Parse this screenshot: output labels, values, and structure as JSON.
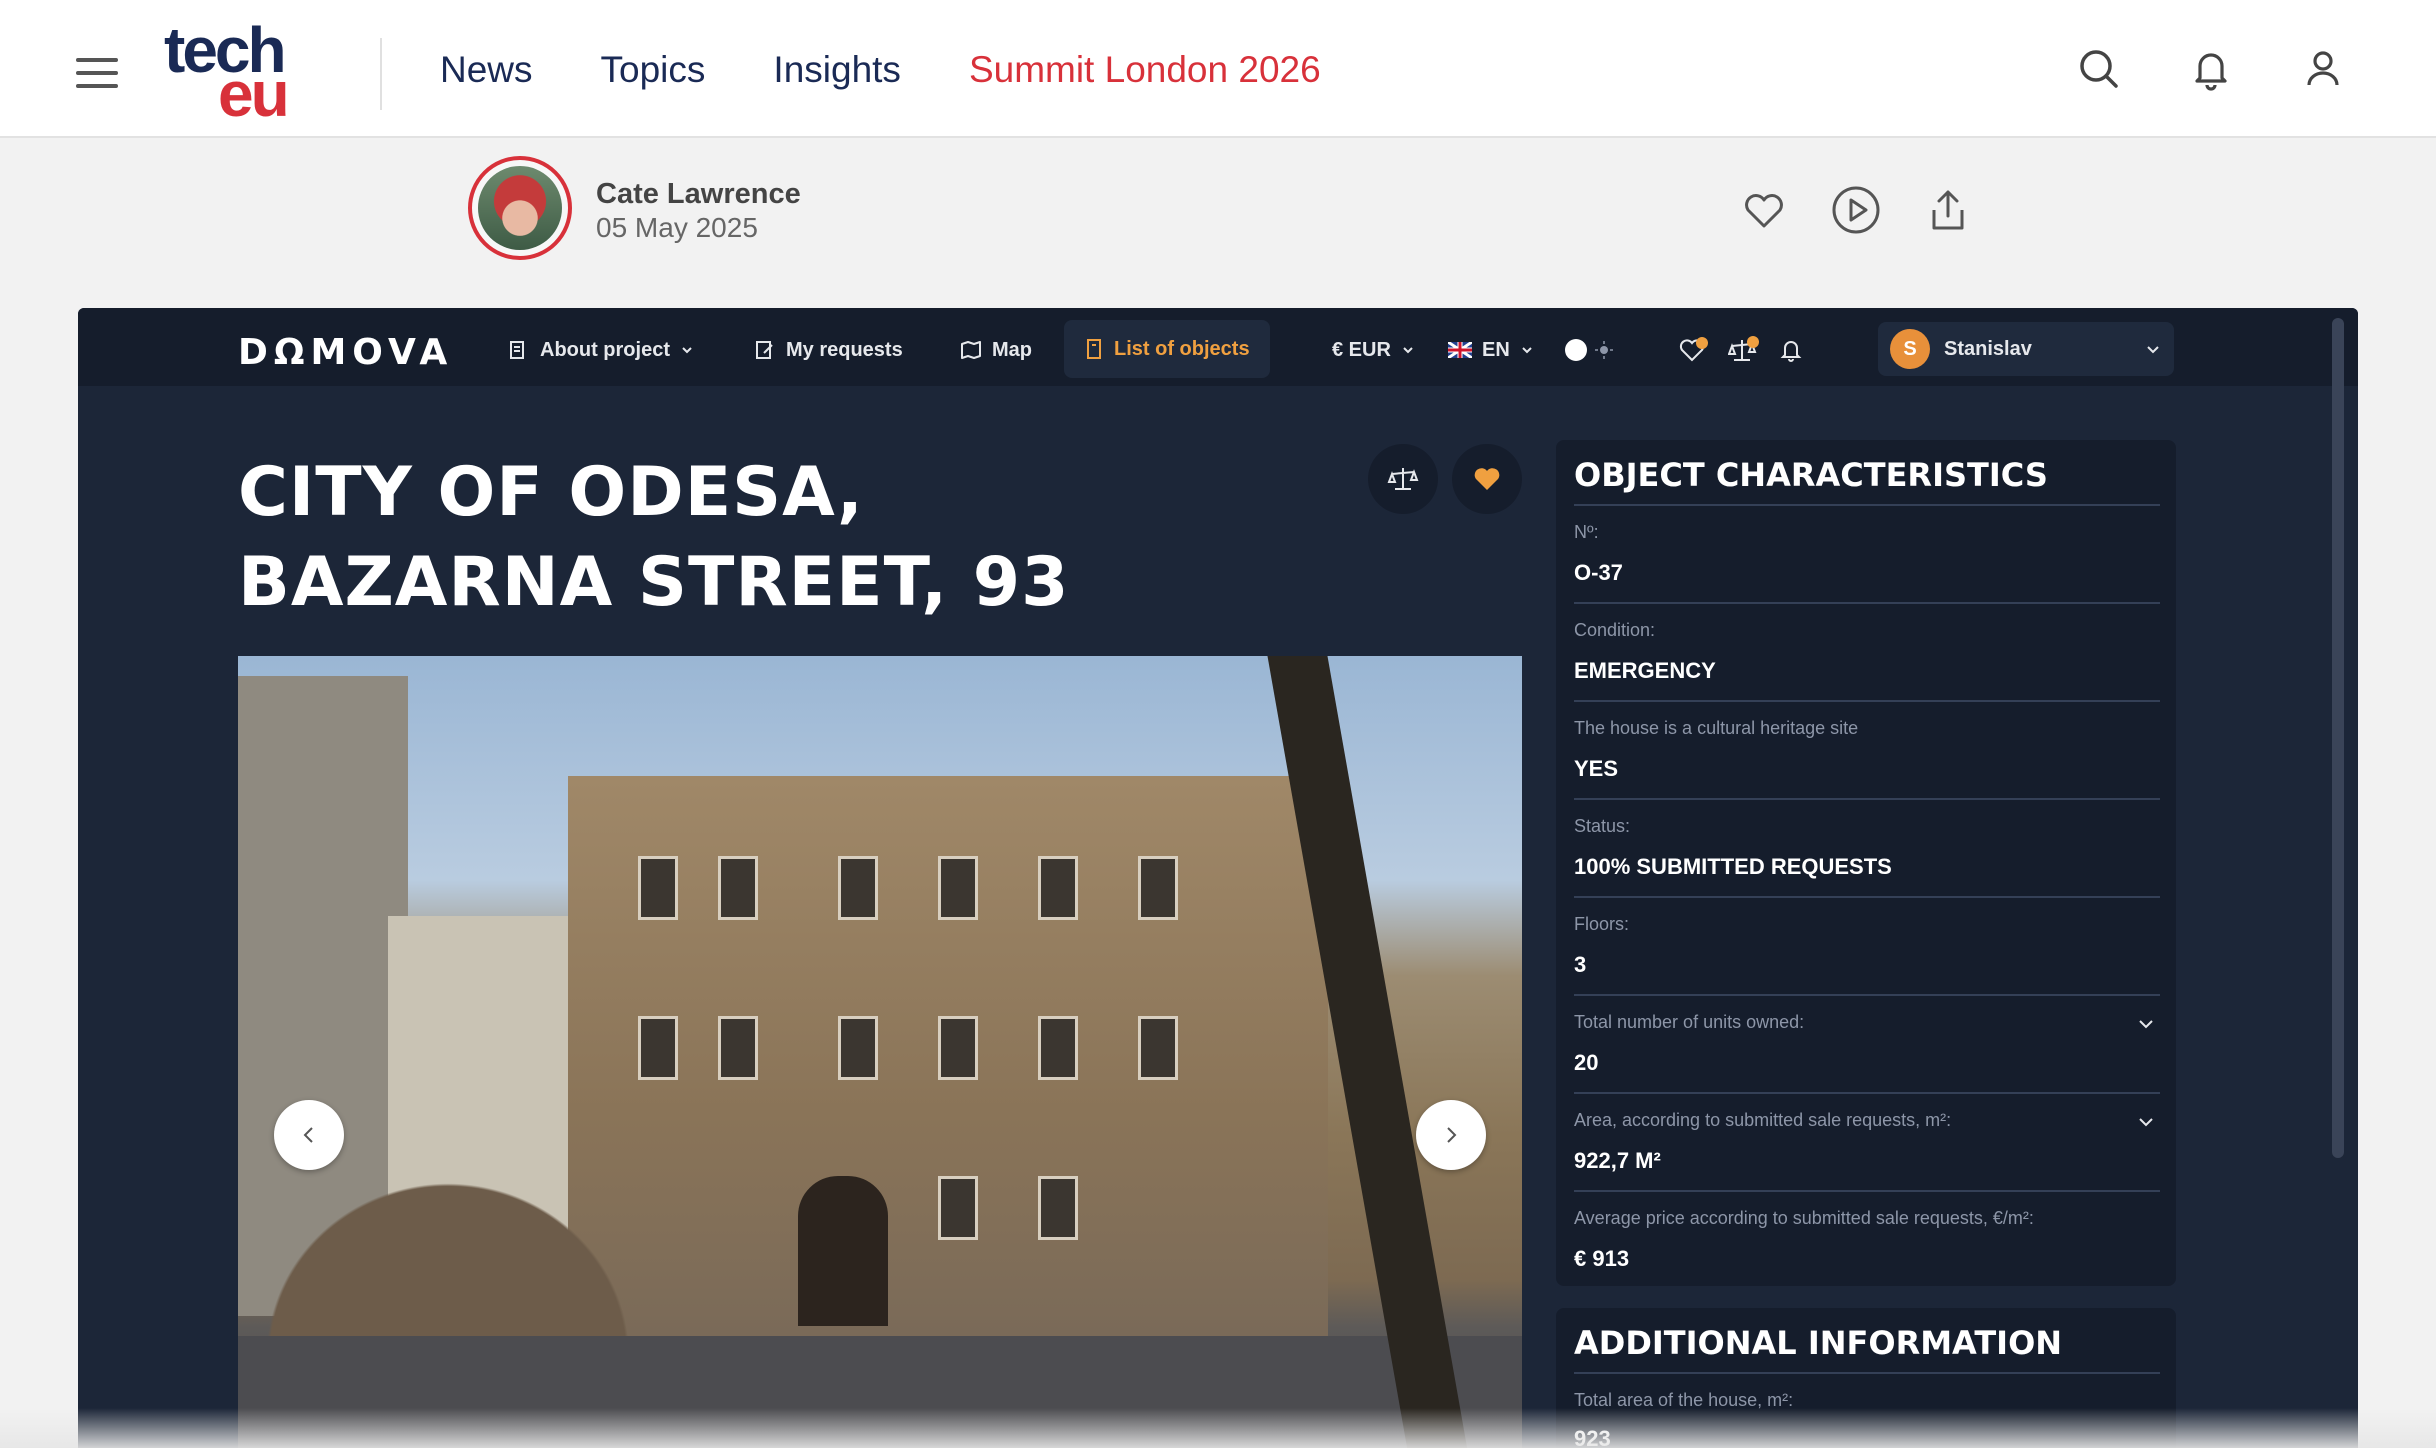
{
  "site": {
    "logo_top": "tech",
    "logo_bottom": "eu",
    "nav": [
      {
        "label": "News"
      },
      {
        "label": "Topics"
      },
      {
        "label": "Insights"
      },
      {
        "label": "Summit London 2026"
      }
    ],
    "accent_color": "#d8313a",
    "brand_color": "#1a2a55",
    "header_icons": [
      "search-icon",
      "bell-icon",
      "user-icon"
    ]
  },
  "article": {
    "author": "Cate Lawrence",
    "date": "05 May 2025",
    "actions": [
      "heart-icon",
      "play-icon",
      "share-icon"
    ]
  },
  "embed": {
    "logo": "DΩMOVA",
    "nav": [
      {
        "label": "About project"
      },
      {
        "label": "My requests"
      },
      {
        "label": "Map"
      },
      {
        "label": "List of objects"
      }
    ],
    "currency": "€ EUR",
    "language": "EN",
    "user_initial": "S",
    "user_name": "Stanislav",
    "title": "CITY OF ODESA, BAZARNA STREET, 93",
    "characteristics_title": "OBJECT CHARACTERISTICS",
    "characteristics": [
      {
        "label": "Nº:",
        "value": "O-37"
      },
      {
        "label": "Condition:",
        "value": "EMERGENCY"
      },
      {
        "label": "The house is a cultural heritage site",
        "value": "YES"
      },
      {
        "label": "Status:",
        "value": "100% SUBMITTED REQUESTS"
      },
      {
        "label": "Floors:",
        "value": "3"
      },
      {
        "label": "Total number of units owned:",
        "value": "20"
      },
      {
        "label": "Area, according to submitted sale requests, m²:",
        "value": "922,7 M²"
      },
      {
        "label": "Average price according to submitted sale requests, €/m²:",
        "value": "€ 913"
      }
    ],
    "additional_title": "ADDITIONAL INFORMATION",
    "additional": [
      {
        "label": "Total area of the house, m²:",
        "value": "923"
      }
    ],
    "accent_color": "#f0a040"
  }
}
